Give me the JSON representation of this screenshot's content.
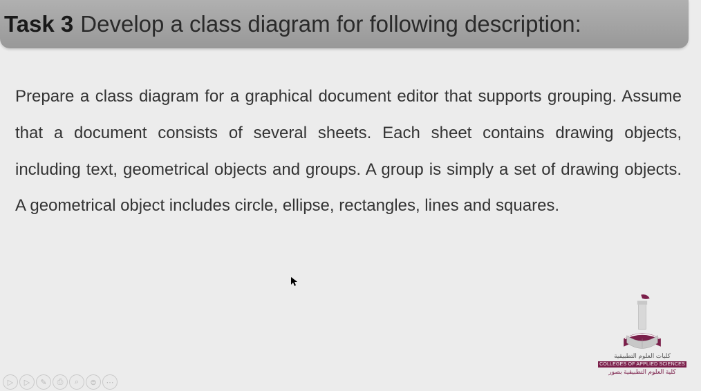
{
  "title": {
    "bold": "Task 3",
    "rest": "Develop a class diagram for following description:"
  },
  "body": "Prepare a class diagram for a graphical document editor that supports grouping. Assume that a document consists of several sheets. Each sheet contains drawing objects, including text, geometrical objects and groups. A group is simply a set of drawing objects. A geometrical object includes circle, ellipse, rectangles, lines and squares.",
  "logo": {
    "line1_ar": "كليات العلوم التطبيقية",
    "line2_en": "COLLEGES OF APPLIED SCIENCES",
    "line3_ar": "كلية العلوم التطبيقية بصور"
  },
  "toolbar": {
    "items": [
      "▷",
      "▷",
      "✎",
      "⎙",
      "⌕",
      "⊜",
      "⋯"
    ]
  }
}
